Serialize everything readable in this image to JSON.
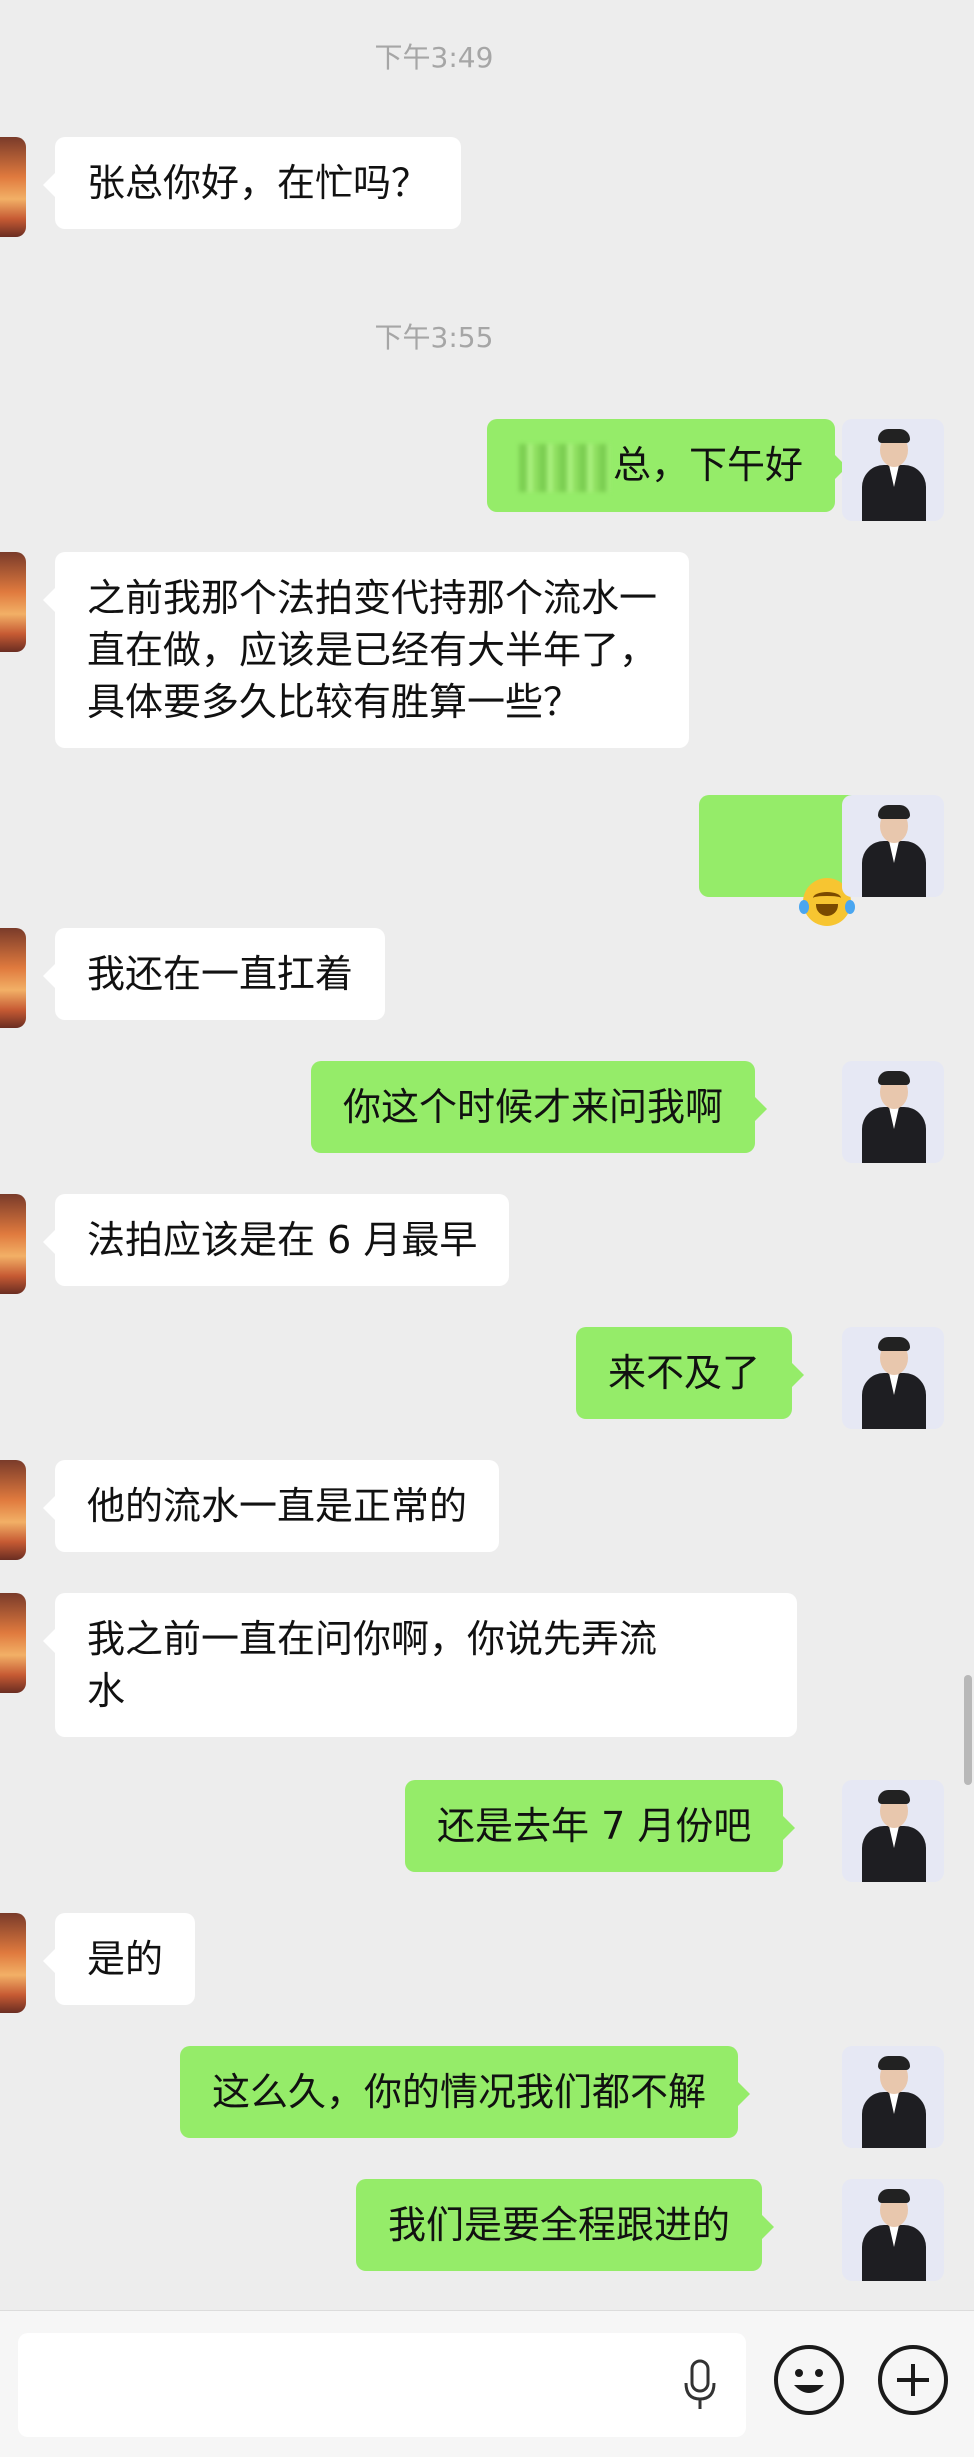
{
  "chat": {
    "timestamps": [
      "下午3:49",
      "下午3:55"
    ],
    "messages": [
      {
        "side": "left",
        "text": "张总你好，在忙吗？"
      },
      {
        "side": "right",
        "text": "总，下午好",
        "redacted_prefix": true
      },
      {
        "side": "left",
        "text": "之前我那个法拍变代持那个流水一\n直在做，应该是已经有大半年了，\n具体要多久比较有胜算一些？"
      },
      {
        "side": "right",
        "text": "",
        "emoji": "crying-laughing-face"
      },
      {
        "side": "left",
        "text": "我还在一直扛着"
      },
      {
        "side": "right",
        "text": "你这个时候才来问我啊"
      },
      {
        "side": "left",
        "text": "法拍应该是在 6 月最早"
      },
      {
        "side": "right",
        "text": "来不及了"
      },
      {
        "side": "left",
        "text": "他的流水一直是正常的"
      },
      {
        "side": "left",
        "text": "我之前一直在问你啊，你说先弄流\n水"
      },
      {
        "side": "right",
        "text": "还是去年 7 月份吧"
      },
      {
        "side": "left",
        "text": "是的"
      },
      {
        "side": "right",
        "text": "这么久，你的情况我们都不解"
      },
      {
        "side": "right",
        "text": "我们是要全程跟进的"
      }
    ]
  },
  "input_bar": {
    "placeholder": "",
    "icons": [
      "microphone-icon",
      "emoji-icon",
      "plus-icon"
    ]
  },
  "colors": {
    "background": "#ededed",
    "outgoing_bubble": "#95ec69",
    "incoming_bubble": "#ffffff",
    "timestamp_text": "#a6a6a6"
  }
}
